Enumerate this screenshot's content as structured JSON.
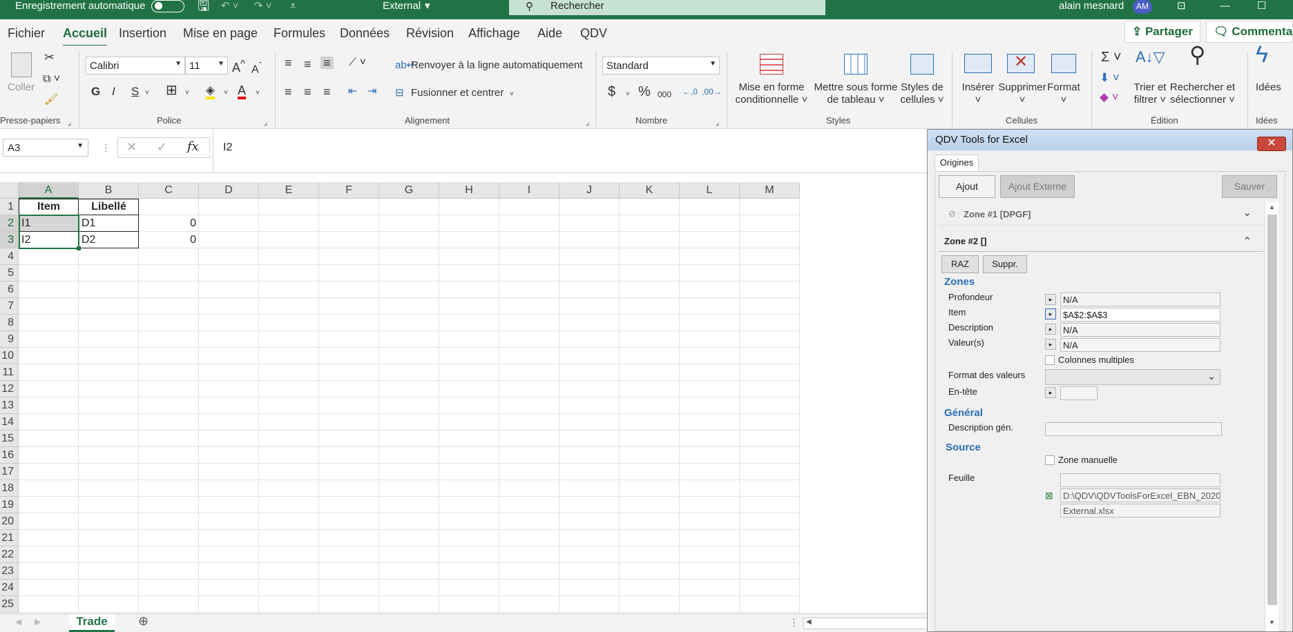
{
  "titlebar": {
    "autosave": "Enregistrement automatique",
    "filename": "External",
    "search_placeholder": "Rechercher",
    "user": "alain mesnard",
    "initials": "AM"
  },
  "menu": {
    "tabs": [
      "Fichier",
      "Accueil",
      "Insertion",
      "Mise en page",
      "Formules",
      "Données",
      "Révision",
      "Affichage",
      "Aide",
      "QDV"
    ],
    "share": "Partager",
    "comments": "Commentaires"
  },
  "ribbon": {
    "clipboard": {
      "paste": "Coller",
      "group": "Presse-papiers"
    },
    "font": {
      "name": "Calibri",
      "size": "11",
      "bold": "G",
      "italic": "I",
      "underline": "S",
      "group": "Police"
    },
    "alignment": {
      "wrap": "Renvoyer à la ligne automatiquement",
      "merge": "Fusionner et centrer",
      "group": "Alignement"
    },
    "number": {
      "format": "Standard",
      "currency": "$",
      "percent": "%",
      "thousands": "000",
      "group": "Nombre"
    },
    "styles": {
      "conditional": [
        "Mise en forme",
        "conditionnelle ˅"
      ],
      "table": [
        "Mettre sous forme",
        "de tableau ˅"
      ],
      "cell": [
        "Styles de",
        "cellules ˅"
      ],
      "group": "Styles"
    },
    "cells": {
      "insert": "Insérer",
      "delete": "Supprimer",
      "format": "Format",
      "group": "Cellules"
    },
    "editing": {
      "sort": [
        "Trier et",
        "filtrer ˅"
      ],
      "find": [
        "Rechercher et",
        "sélectionner ˅"
      ],
      "group": "Édition"
    },
    "ideas": {
      "label": "Idées",
      "group": "Idées"
    }
  },
  "formula": {
    "cell_ref": "A3",
    "content": "I2"
  },
  "sheet": {
    "columns": [
      "A",
      "B",
      "C",
      "D",
      "E",
      "F",
      "G",
      "H",
      "I",
      "J",
      "K",
      "L",
      "M"
    ],
    "rows": [
      "1",
      "2",
      "3",
      "4",
      "5",
      "6",
      "7",
      "8",
      "9",
      "10",
      "11",
      "12",
      "13",
      "14",
      "15",
      "16",
      "17",
      "18",
      "19",
      "20",
      "21",
      "22",
      "23",
      "24",
      "25"
    ],
    "cells": {
      "A1": "Item",
      "B1": "Libellé",
      "A2": "I1",
      "B2": "D1",
      "C2": "0",
      "A3": "I2",
      "B3": "D2",
      "C3": "0"
    },
    "tab": "Trade"
  },
  "panel": {
    "title": "QDV Tools for Excel",
    "tab": "Origines",
    "buttons": {
      "add": "Ajout",
      "add_external": "Ajout Externe",
      "save": "Sauver",
      "reset": "RAZ",
      "delete": "Suppr."
    },
    "zone1": "Zone #1 [DPGF]",
    "zone2": "Zone #2 []",
    "zones": {
      "title": "Zones",
      "depth_label": "Profondeur",
      "depth_value": "N/A",
      "item_label": "Item",
      "item_value": "$A$2:$A$3",
      "desc_label": "Description",
      "desc_value": "N/A",
      "values_label": "Valeur(s)",
      "values_value": "N/A",
      "multi_cols": "Colonnes multiples",
      "format_label": "Format des valeurs",
      "header_label": "En-tête"
    },
    "general": {
      "title": "Général",
      "desc_label": "Description gén."
    },
    "source": {
      "title": "Source",
      "manual": "Zone manuelle",
      "sheet_label": "Feuille",
      "path": "D:\\QDV\\QDVToolsForExcel_EBN_2020",
      "file": "External.xlsx"
    }
  }
}
